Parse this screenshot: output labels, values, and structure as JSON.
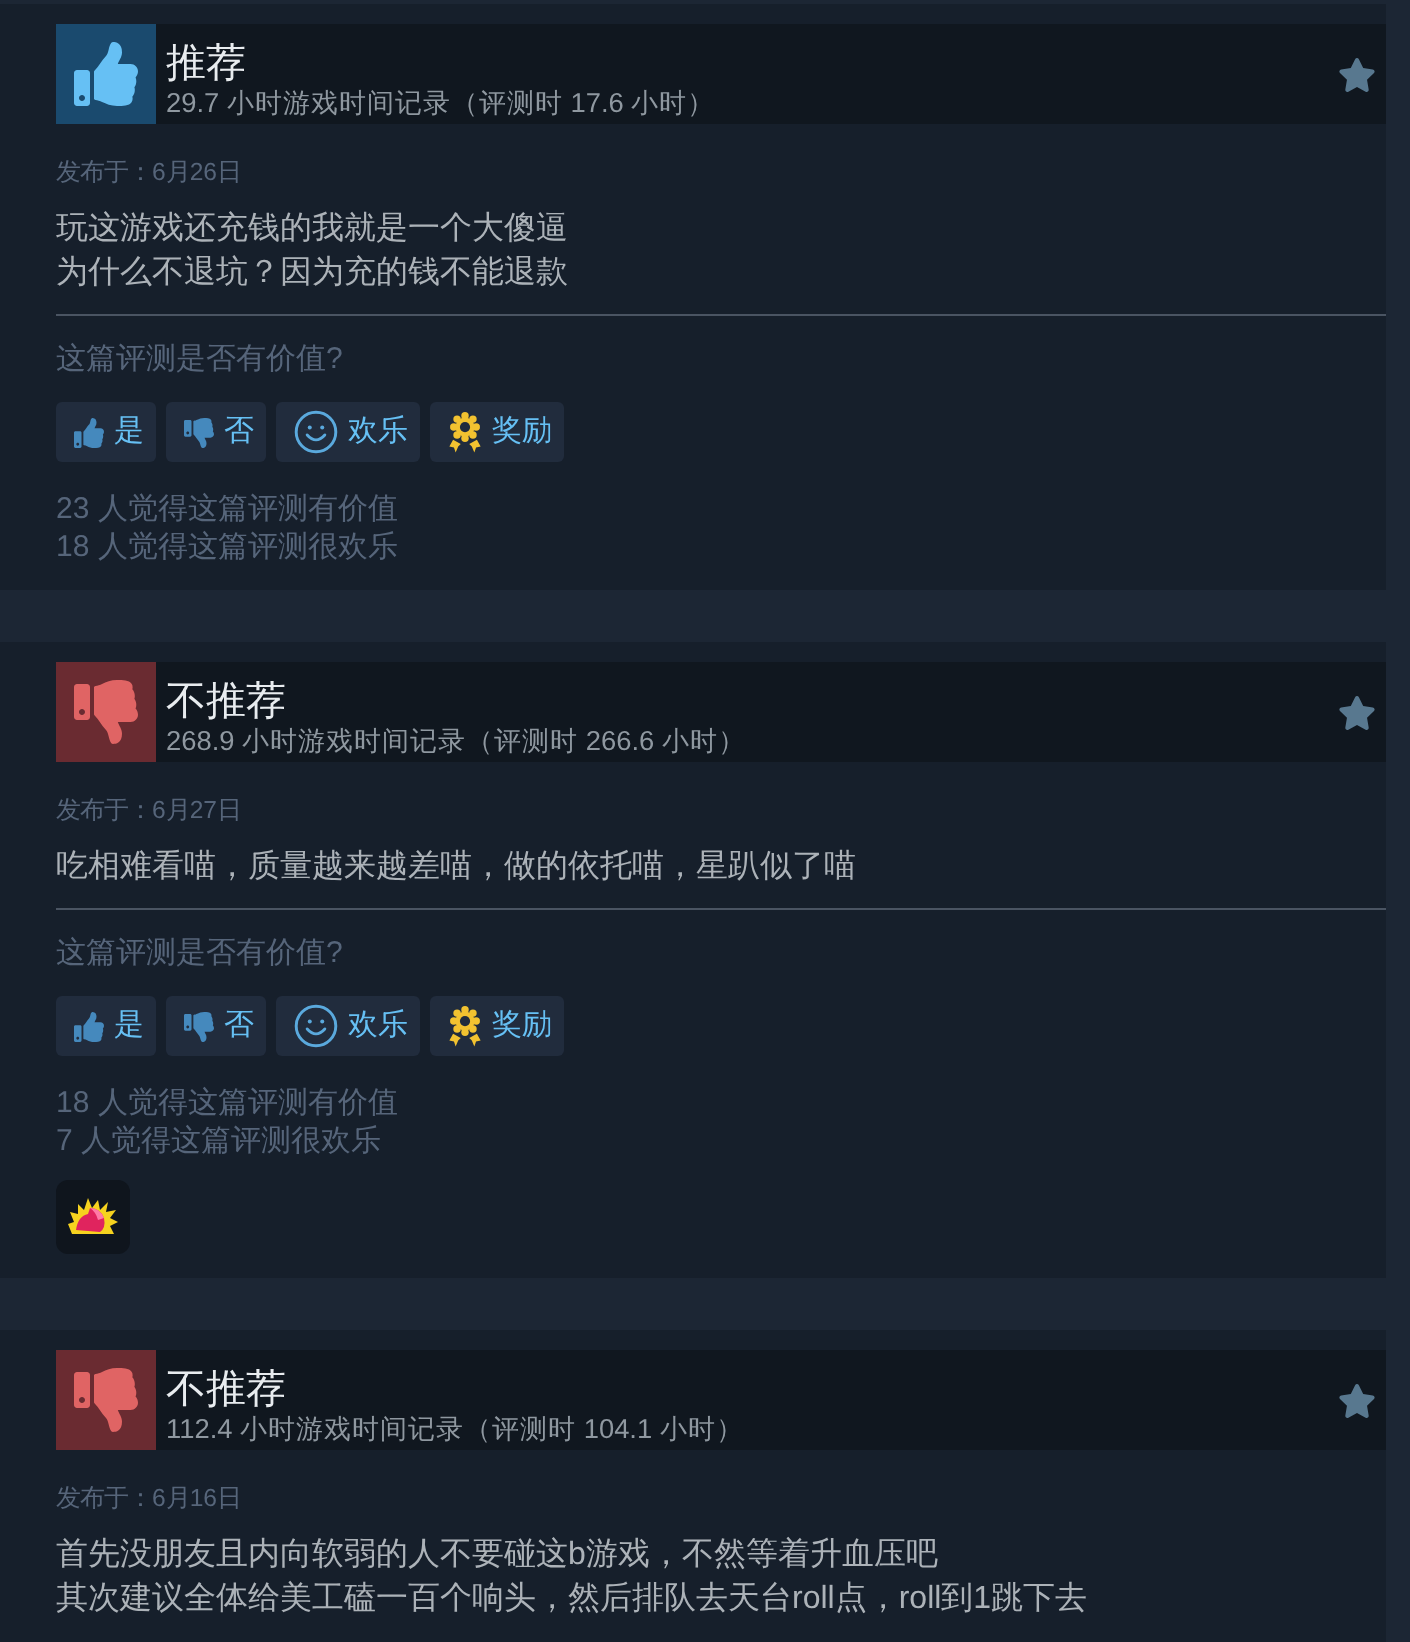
{
  "reviews": [
    {
      "recommended": true,
      "verdict": "推荐",
      "playtime": "29.7 小时游戏时间记录（评测时 17.6 小时）",
      "posted": "发布于：6月26日",
      "body": [
        "玩这游戏还充钱的我就是一个大傻逼",
        "为什么不退坑？因为充的钱不能退款"
      ],
      "question": "这篇评测是否有价值?",
      "vote_buttons": [
        {
          "kind": "yes",
          "label": "是"
        },
        {
          "kind": "no",
          "label": "否"
        },
        {
          "kind": "funny",
          "label": "欢乐"
        },
        {
          "kind": "award",
          "label": "奖励"
        }
      ],
      "counts": [
        "23 人觉得这篇评测有价值",
        "18 人觉得这篇评测很欢乐"
      ]
    },
    {
      "recommended": false,
      "verdict": "不推荐",
      "playtime": "268.9 小时游戏时间记录（评测时 266.6 小时）",
      "posted": "发布于：6月27日",
      "body": [
        "吃相难看喵，质量越来越差喵，做的依托喵，星趴似了喵"
      ],
      "question": "这篇评测是否有价值?",
      "vote_buttons": [
        {
          "kind": "yes",
          "label": "是"
        },
        {
          "kind": "no",
          "label": "否"
        },
        {
          "kind": "funny",
          "label": "欢乐"
        },
        {
          "kind": "award",
          "label": "奖励"
        }
      ],
      "counts": [
        "18 人觉得这篇评测有价值",
        "7 人觉得这篇评测很欢乐"
      ],
      "awards": [
        {
          "kind": "flame"
        }
      ]
    },
    {
      "recommended": false,
      "verdict": "不推荐",
      "playtime": "112.4 小时游戏时间记录（评测时 104.1 小时）",
      "posted": "发布于：6月16日",
      "body": [
        "首先没朋友且内向软弱的人不要碰这b游戏，不然等着升血压吧",
        "其次建议全体给美工磕一百个响头，然后排队去天台roll点，roll到1跳下去"
      ]
    }
  ]
}
